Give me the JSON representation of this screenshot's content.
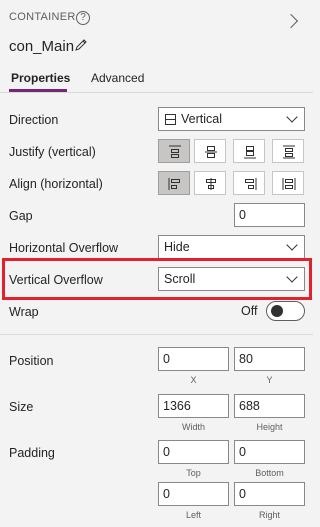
{
  "header": {
    "type_label": "CONTAINER",
    "help_glyph": "?",
    "control_name": "con_Main"
  },
  "tabs": [
    {
      "label": "Properties",
      "active": true
    },
    {
      "label": "Advanced",
      "active": false
    }
  ],
  "properties": {
    "direction": {
      "label": "Direction",
      "value": "Vertical"
    },
    "justify": {
      "label": "Justify (vertical)",
      "selected_index": 0
    },
    "align": {
      "label": "Align (horizontal)",
      "selected_index": 0
    },
    "gap": {
      "label": "Gap",
      "value": "0"
    },
    "horizontal_overflow": {
      "label": "Horizontal Overflow",
      "value": "Hide"
    },
    "vertical_overflow": {
      "label": "Vertical Overflow",
      "value": "Scroll"
    },
    "wrap": {
      "label": "Wrap",
      "state_label": "Off",
      "on": false
    },
    "position": {
      "label": "Position",
      "x": "0",
      "y": "80",
      "x_caption": "X",
      "y_caption": "Y"
    },
    "size": {
      "label": "Size",
      "width": "1366",
      "height": "688",
      "width_caption": "Width",
      "height_caption": "Height"
    },
    "padding": {
      "label": "Padding",
      "top": "0",
      "bottom": "0",
      "left": "0",
      "right": "0",
      "top_caption": "Top",
      "bottom_caption": "Bottom",
      "left_caption": "Left",
      "right_caption": "Right"
    }
  },
  "colors": {
    "accent": "#742774",
    "highlight": "#e3212c",
    "selected_button": "#c8c6c4"
  }
}
